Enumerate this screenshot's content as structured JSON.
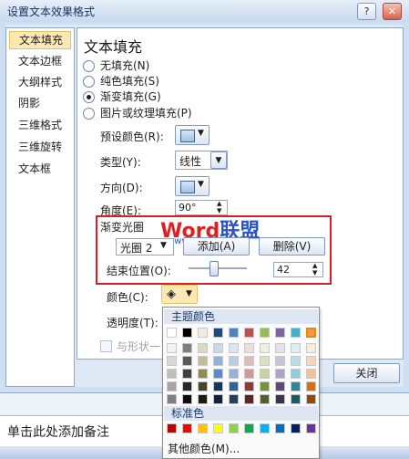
{
  "window": {
    "title": "设置文本效果格式",
    "help_btn": "?",
    "close_btn": "✕"
  },
  "categories": [
    {
      "label": "文本填充",
      "selected": true
    },
    {
      "label": "文本边框",
      "selected": false
    },
    {
      "label": "大纲样式",
      "selected": false
    },
    {
      "label": "阴影",
      "selected": false
    },
    {
      "label": "三维格式",
      "selected": false
    },
    {
      "label": "三维旋转",
      "selected": false
    },
    {
      "label": "文本框",
      "selected": false
    }
  ],
  "panel": {
    "title": "文本填充",
    "fill_options": [
      {
        "label": "无填充(N)",
        "checked": false
      },
      {
        "label": "纯色填充(S)",
        "checked": false
      },
      {
        "label": "渐变填充(G)",
        "checked": true
      },
      {
        "label": "图片或纹理填充(P)",
        "checked": false
      }
    ],
    "preset_label": "预设颜色(R):",
    "type_label": "类型(Y):",
    "type_value": "线性",
    "direction_label": "方向(D):",
    "angle_label": "角度(E):",
    "angle_value": "90°",
    "stops_label": "渐变光圈",
    "stop_value": "光圈 2",
    "add_btn": "添加(A)",
    "remove_btn": "删除(V)",
    "end_pos_label": "结束位置(O):",
    "end_pos_value": "42",
    "end_pos_fraction": 0.42,
    "color_label": "颜色(C):",
    "transparency_label": "透明度(T):",
    "rotate_label": "与形状一",
    "close_btn": "关闭"
  },
  "watermark": {
    "word": "Word",
    "cn": "联盟",
    "url": "www.wordlm.com"
  },
  "color_popup": {
    "theme_header": "主题颜色",
    "standard_header": "标准色",
    "more_colors": "其他颜色(M)...",
    "theme_top": [
      "#ffffff",
      "#000000",
      "#eeece1",
      "#1f497d",
      "#4f81bd",
      "#c0504d",
      "#9bbb59",
      "#8064a2",
      "#4bacc6",
      "#f79646"
    ],
    "theme_shades": [
      [
        "#f2f2f2",
        "#7f7f7f",
        "#ddd9c3",
        "#c6d9f0",
        "#dbe5f1",
        "#f2dcdb",
        "#ebf1dd",
        "#e5e0ec",
        "#dbeef3",
        "#fdeada"
      ],
      [
        "#d8d8d8",
        "#595959",
        "#c4bd97",
        "#8db3e2",
        "#b8cce4",
        "#e5b9b7",
        "#d7e3bc",
        "#ccc1d9",
        "#b7dde8",
        "#fbd5b5"
      ],
      [
        "#bfbfbf",
        "#3f3f3f",
        "#938953",
        "#548dd4",
        "#95b3d7",
        "#d99694",
        "#c3d69b",
        "#b2a2c7",
        "#92cddc",
        "#fac08f"
      ],
      [
        "#a5a5a5",
        "#262626",
        "#494429",
        "#17365d",
        "#366092",
        "#953734",
        "#76923c",
        "#5f497a",
        "#31859b",
        "#e36c09"
      ],
      [
        "#7f7f7f",
        "#0c0c0c",
        "#1d1b10",
        "#0f243e",
        "#244061",
        "#632423",
        "#4f6128",
        "#3f3151",
        "#205867",
        "#974806"
      ]
    ],
    "standard": [
      "#c00000",
      "#ff0000",
      "#ffc000",
      "#ffff00",
      "#92d050",
      "#00b050",
      "#00b0f0",
      "#0070c0",
      "#002060",
      "#7030a0"
    ]
  },
  "document": {
    "notes_placeholder": "单击此处添加备注"
  }
}
